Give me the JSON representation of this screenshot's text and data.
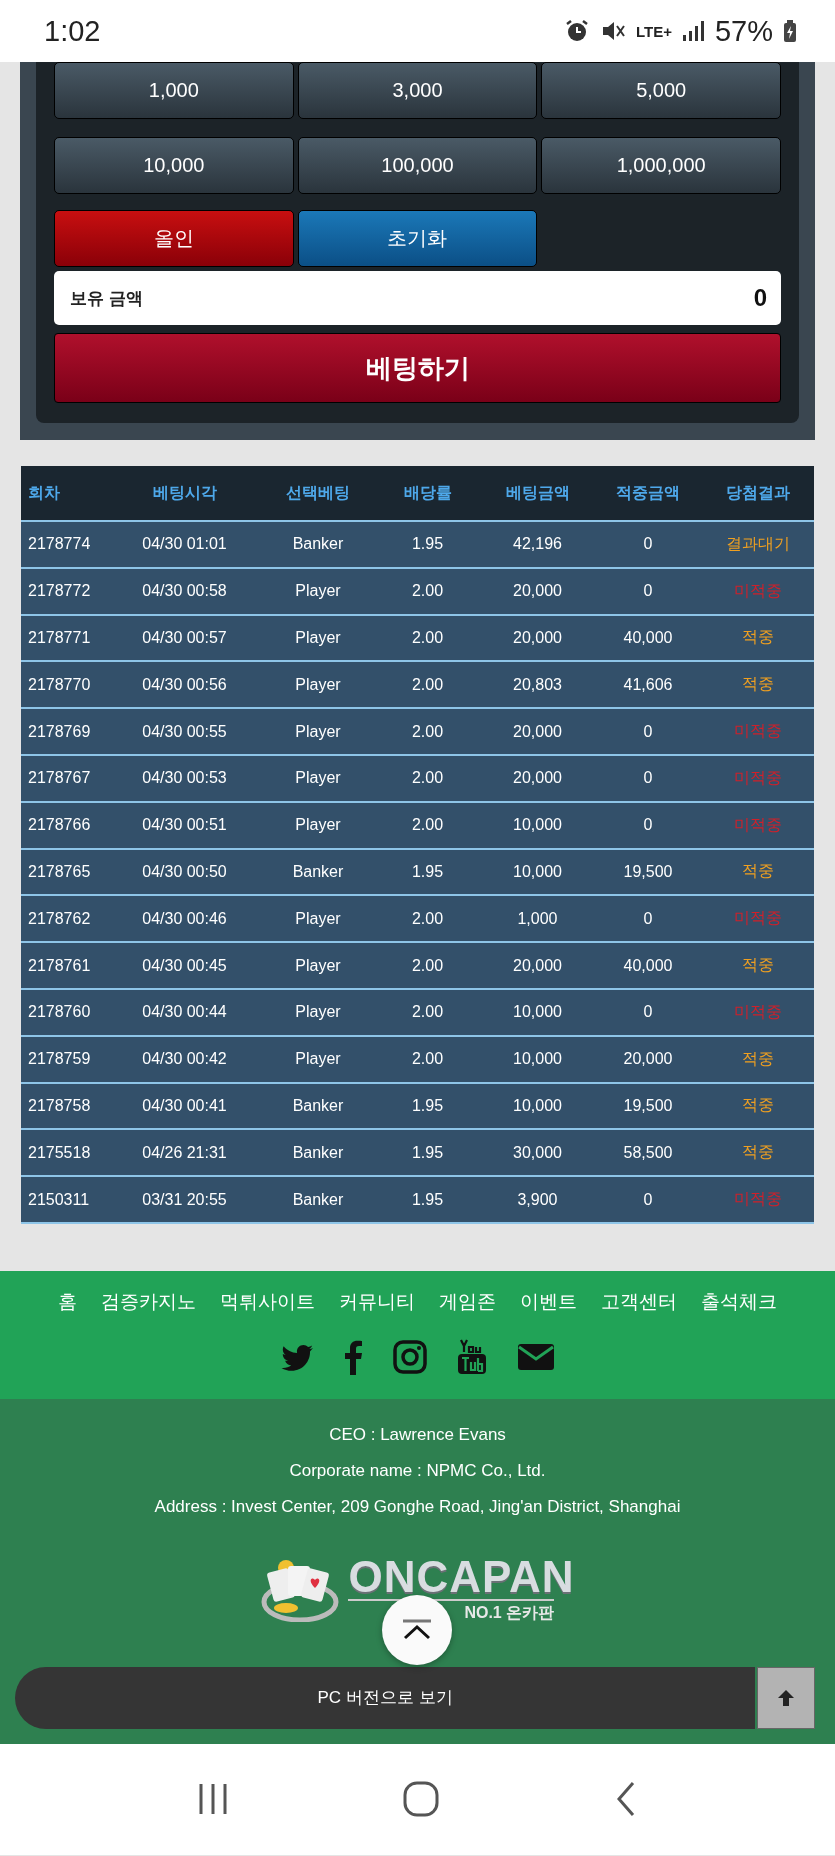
{
  "status_bar": {
    "time": "1:02",
    "network": "LTE+",
    "battery": "57%"
  },
  "bet_panel": {
    "chips": [
      "1,000",
      "3,000",
      "5,000",
      "10,000",
      "100,000",
      "1,000,000"
    ],
    "actions": [
      {
        "label": "올인",
        "kind": "allin"
      },
      {
        "label": "초기화",
        "kind": "reset"
      }
    ],
    "balance": {
      "label": "보유 금액",
      "value": "0"
    },
    "bet_button": "베팅하기"
  },
  "table": {
    "columns": [
      "회차",
      "베팅시각",
      "선택베팅",
      "배당률",
      "베팅금액",
      "적중금액",
      "당첨결과"
    ],
    "rows": [
      {
        "round": "2178774",
        "time": "04/30 01:01",
        "pick": "Banker",
        "odds": "1.95",
        "bet": "42,196",
        "win": "0",
        "result": "결과대기",
        "color": "#f0a020"
      },
      {
        "round": "2178772",
        "time": "04/30 00:58",
        "pick": "Player",
        "odds": "2.00",
        "bet": "20,000",
        "win": "0",
        "result": "미적중",
        "color": "#d0202a"
      },
      {
        "round": "2178771",
        "time": "04/30 00:57",
        "pick": "Player",
        "odds": "2.00",
        "bet": "20,000",
        "win": "40,000",
        "result": "적중",
        "color": "#f0a020"
      },
      {
        "round": "2178770",
        "time": "04/30 00:56",
        "pick": "Player",
        "odds": "2.00",
        "bet": "20,803",
        "win": "41,606",
        "result": "적중",
        "color": "#f0a020"
      },
      {
        "round": "2178769",
        "time": "04/30 00:55",
        "pick": "Player",
        "odds": "2.00",
        "bet": "20,000",
        "win": "0",
        "result": "미적중",
        "color": "#d0202a"
      },
      {
        "round": "2178767",
        "time": "04/30 00:53",
        "pick": "Player",
        "odds": "2.00",
        "bet": "20,000",
        "win": "0",
        "result": "미적중",
        "color": "#d0202a"
      },
      {
        "round": "2178766",
        "time": "04/30 00:51",
        "pick": "Player",
        "odds": "2.00",
        "bet": "10,000",
        "win": "0",
        "result": "미적중",
        "color": "#d0202a"
      },
      {
        "round": "2178765",
        "time": "04/30 00:50",
        "pick": "Banker",
        "odds": "1.95",
        "bet": "10,000",
        "win": "19,500",
        "result": "적중",
        "color": "#f0a020"
      },
      {
        "round": "2178762",
        "time": "04/30 00:46",
        "pick": "Player",
        "odds": "2.00",
        "bet": "1,000",
        "win": "0",
        "result": "미적중",
        "color": "#d0202a"
      },
      {
        "round": "2178761",
        "time": "04/30 00:45",
        "pick": "Player",
        "odds": "2.00",
        "bet": "20,000",
        "win": "40,000",
        "result": "적중",
        "color": "#f0a020"
      },
      {
        "round": "2178760",
        "time": "04/30 00:44",
        "pick": "Player",
        "odds": "2.00",
        "bet": "10,000",
        "win": "0",
        "result": "미적중",
        "color": "#d0202a"
      },
      {
        "round": "2178759",
        "time": "04/30 00:42",
        "pick": "Player",
        "odds": "2.00",
        "bet": "10,000",
        "win": "20,000",
        "result": "적중",
        "color": "#f0a020"
      },
      {
        "round": "2178758",
        "time": "04/30 00:41",
        "pick": "Banker",
        "odds": "1.95",
        "bet": "10,000",
        "win": "19,500",
        "result": "적중",
        "color": "#f0a020"
      },
      {
        "round": "2175518",
        "time": "04/26 21:31",
        "pick": "Banker",
        "odds": "1.95",
        "bet": "30,000",
        "win": "58,500",
        "result": "적중",
        "color": "#f0a020"
      },
      {
        "round": "2150311",
        "time": "03/31 20:55",
        "pick": "Banker",
        "odds": "1.95",
        "bet": "3,900",
        "win": "0",
        "result": "미적중",
        "color": "#d0202a"
      }
    ]
  },
  "footer": {
    "nav": [
      "홈",
      "검증카지노",
      "먹튀사이트",
      "커뮤니티",
      "게임존",
      "이벤트",
      "고객센터",
      "출석체크"
    ],
    "social": [
      {
        "kind": "twitter"
      },
      {
        "kind": "facebook"
      },
      {
        "kind": "instagram"
      },
      {
        "kind": "youtube"
      },
      {
        "kind": "mail"
      }
    ],
    "info": [
      "CEO : Lawrence Evans",
      "Corporate name : NPMC Co., Ltd.",
      "Address : Invest Center, 209 Gonghe Road, Jing'an District, Shanghai"
    ],
    "logo": {
      "name": "ONCAPAN",
      "tagline": "NO.1 온카판"
    },
    "pc_version": "PC 버전으로 보기"
  }
}
